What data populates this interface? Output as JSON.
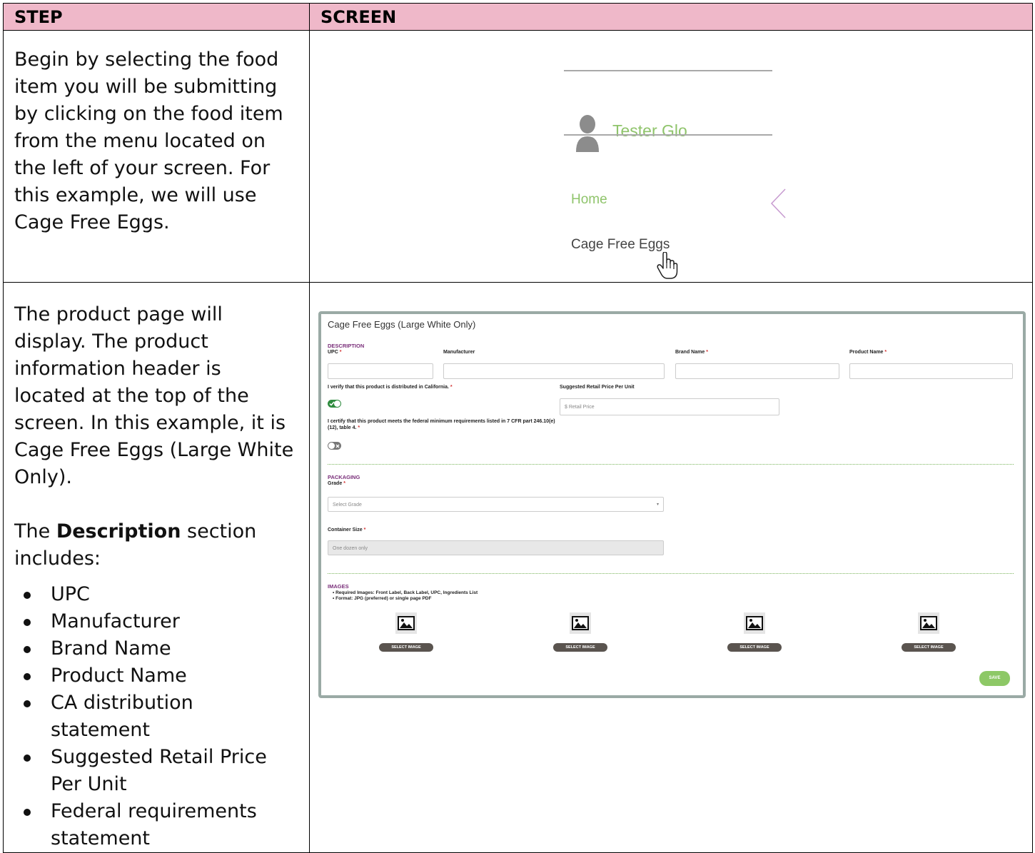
{
  "table": {
    "header_step": "STEP",
    "header_screen": "SCREEN"
  },
  "row1": {
    "step_text": "Begin by selecting the food item you will be submitting by clicking on the food item from the menu located on the left of your screen.  For this example, we will use Cage Free Eggs.",
    "menu": {
      "user_name": "Tester Glo",
      "home": "Home",
      "cage_free_eggs": "Cage Free Eggs"
    }
  },
  "row2": {
    "p1": "The product page will display. The product information header is located at the top of the screen.  In this example, it is Cage Free Eggs (Large White Only).",
    "p2_prefix": "The ",
    "p2_bold": "Description",
    "p2_suffix": " section includes:",
    "bullets": [
      "UPC",
      "Manufacturer",
      "Brand Name",
      "Product Name",
      "CA distribution statement",
      "Suggested Retail Price Per Unit",
      "Federal requirements statement"
    ],
    "form": {
      "title": "Cage Free Eggs (Large White Only)",
      "description_heading": "DESCRIPTION",
      "upc_label": "UPC",
      "manufacturer_label": "Manufacturer",
      "brand_label": "Brand Name",
      "product_label": "Product Name",
      "verify_label": "I verify that this product is distributed in California.",
      "verify_on": true,
      "price_label": "Suggested Retail Price Per Unit",
      "price_placeholder": "$  Retail Price",
      "certify_label": "I certify that this product meets the federal minimum requirements listed in 7 CFR part 246.10(e)(12), table 4.",
      "certify_on": false,
      "packaging_heading": "PACKAGING",
      "grade_label": "Grade",
      "grade_placeholder": "Select Grade",
      "container_label": "Container Size",
      "container_value": "One dozen only",
      "images_heading": "IMAGES",
      "images_bullet1": "Required Images: Front Label, Back Label, UPC, Ingredients List",
      "images_bullet2": "Format: JPG (preferred) or single page PDF",
      "select_image_label": "SELECT IMAGE",
      "save_label": "SAVE",
      "required_mark": "*"
    }
  },
  "colors": {
    "header_bg": "#efb8c9",
    "green": "#8fc46b",
    "purple": "#7a2f7a"
  }
}
